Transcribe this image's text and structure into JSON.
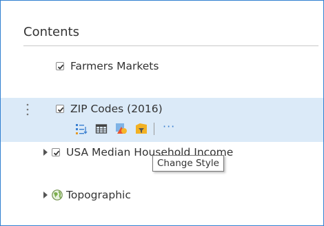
{
  "panel": {
    "title": "Contents"
  },
  "layers": [
    {
      "label": "Farmers Markets",
      "checked": true,
      "icon": "check-icon"
    },
    {
      "label": "ZIP Codes (2016)",
      "checked": true,
      "icon": "check-icon",
      "selected": true
    },
    {
      "label": "USA Median Household Income",
      "checked": true,
      "icon": "check-icon",
      "expandable": true
    },
    {
      "label": "Topographic",
      "icon": "globe-icon",
      "expandable": true
    }
  ],
  "toolbar": {
    "tools": [
      "show-legend-icon",
      "attribute-table-icon",
      "change-style-icon",
      "filter-icon"
    ],
    "more_label": "···"
  },
  "tooltip": {
    "text": "Change Style"
  },
  "colors": {
    "border": "#2f7fd0",
    "selected_background": "#dbeaf8",
    "accent": "#3a7fd0",
    "text": "#333333"
  }
}
